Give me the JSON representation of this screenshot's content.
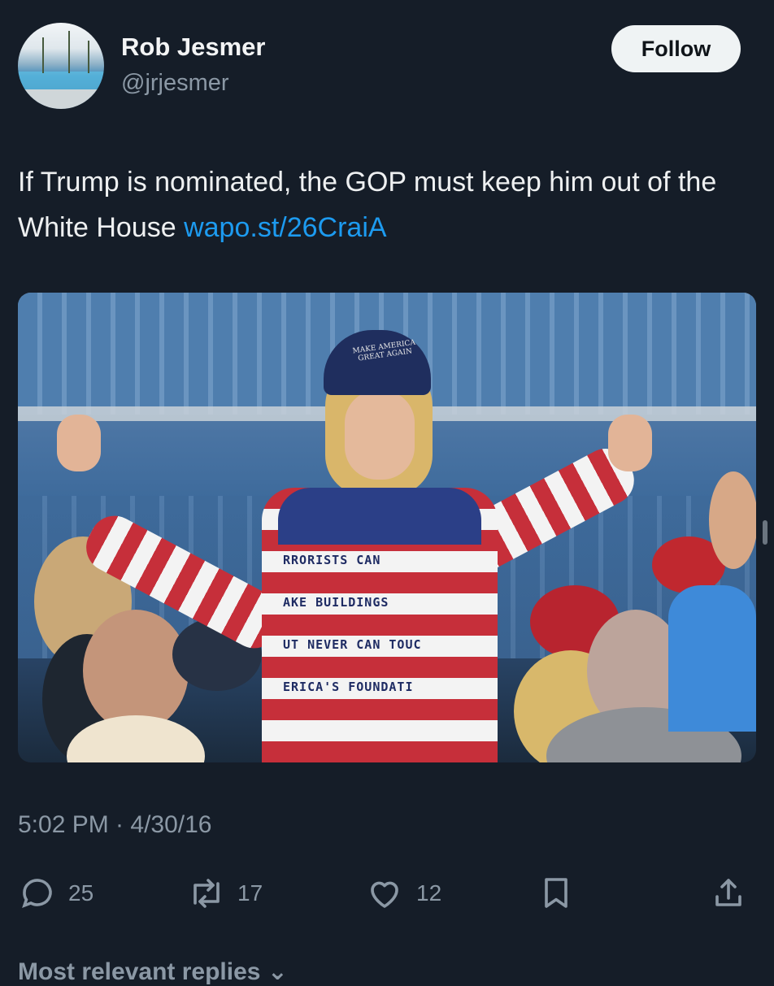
{
  "author": {
    "name": "Rob Jesmer",
    "handle": "@jrjesmer",
    "avatar_icon": "profile-photo-pool-icon"
  },
  "follow_label": "Follow",
  "tweet": {
    "text": "If Trump is nominated, the GOP must keep him out of the White House",
    "link": "wapo.st/26CraiA"
  },
  "photo": {
    "cap_text": "MAKE AMERICA GREAT AGAIN",
    "sweater_lines": [
      "RRORISTS CAN",
      "AKE BUILDINGS",
      "UT NEVER CAN TOUC",
      "ERICA'S FOUNDATI"
    ]
  },
  "timestamp": "5:02 PM · 4/30/16",
  "actions": {
    "replies": "25",
    "reposts": "17",
    "likes": "12"
  },
  "replies_sort_label": "Most relevant replies",
  "colors": {
    "background": "#151d28",
    "link": "#1d9bf0",
    "secondary_text": "#8b98a5"
  }
}
